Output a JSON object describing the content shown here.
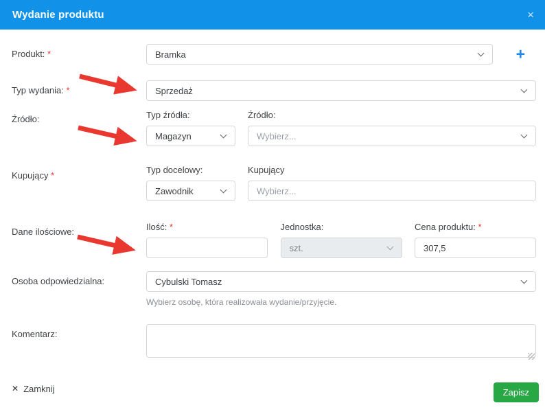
{
  "colors": {
    "header_bg": "#1191e8",
    "accent_red": "#e8382f",
    "save_green": "#28a745",
    "link_blue": "#1d86e8"
  },
  "required_mark": "*",
  "modal": {
    "title": "Wydanie produktu",
    "close_icon": "×"
  },
  "form": {
    "produkt": {
      "label": "Produkt:",
      "value": "Bramka",
      "add_icon": "+"
    },
    "typ_wydania": {
      "label": "Typ wydania:",
      "value": "Sprzedaż"
    },
    "zrodlo": {
      "label": "Źródło:",
      "typ_zrodla_label": "Typ źródła:",
      "typ_zrodla_value": "Magazyn",
      "zrodlo_label": "Źródło:",
      "zrodlo_placeholder": "Wybierz..."
    },
    "kupujacy": {
      "label": "Kupujący",
      "typ_docelowy_label": "Typ docelowy:",
      "typ_docelowy_value": "Zawodnik",
      "kupujacy_label": "Kupujący",
      "kupujacy_placeholder": "Wybierz..."
    },
    "dane_ilosciowe": {
      "label": "Dane ilościowe:",
      "ilosc_label": "Ilość:",
      "ilosc_value": "",
      "jednostka_label": "Jednostka:",
      "jednostka_value": "szt.",
      "cena_label": "Cena produktu:",
      "cena_value": "307,5"
    },
    "osoba": {
      "label": "Osoba odpowiedzialna:",
      "value": "Cybulski Tomasz",
      "helper": "Wybierz osobę, która realizowała wydanie/przyjęcie."
    },
    "komentarz": {
      "label": "Komentarz:"
    }
  },
  "footer": {
    "close_icon": "✕",
    "close_label": "Zamknij",
    "save_label": "Zapisz"
  }
}
